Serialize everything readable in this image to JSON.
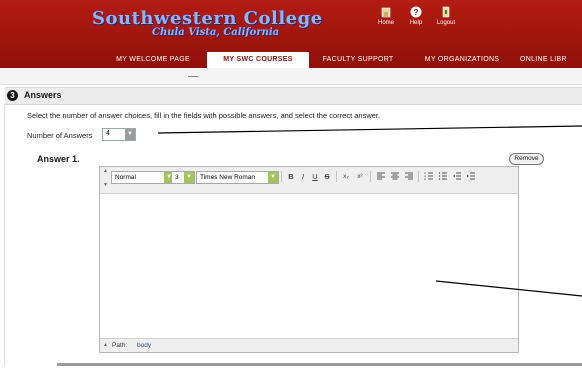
{
  "header": {
    "college_name": "Southwestern College",
    "college_location": "Chula Vista, California",
    "links": [
      {
        "label": "Home",
        "icon": "home-icon"
      },
      {
        "label": "Help",
        "icon": "help-icon"
      },
      {
        "label": "Logout",
        "icon": "logout-icon"
      }
    ]
  },
  "nav": {
    "tabs": [
      {
        "label": "MY WELCOME PAGE",
        "active": false
      },
      {
        "label": "MY SWC COURSES",
        "active": true
      },
      {
        "label": "FACULTY SUPPORT",
        "active": false
      },
      {
        "label": "MY ORGANIZATIONS",
        "active": false
      },
      {
        "label": "ONLINE LIBR",
        "active": false
      }
    ]
  },
  "section": {
    "number": "3",
    "title": "Answers",
    "instructions": "Select the number of answer choices, fill in the fields with possible answers, and select the correct answer.",
    "num_answers_label": "Number of Answers",
    "num_answers_value": "4"
  },
  "answer": {
    "label": "Answer 1.",
    "remove_label": "Remove"
  },
  "editor": {
    "format_value": "Normal",
    "size_value": "3",
    "font_value": "Times New Roman",
    "buttons": {
      "bold": "B",
      "italic": "I",
      "underline": "U",
      "strike": "S",
      "subscript": "x₂",
      "superscript": "x²"
    },
    "path_label": "Path:",
    "path_value": "body"
  },
  "colors": {
    "header_red": "#a3170e",
    "accent_blue": "#8fb4ff",
    "dropdown_green": "#a6c35a"
  }
}
